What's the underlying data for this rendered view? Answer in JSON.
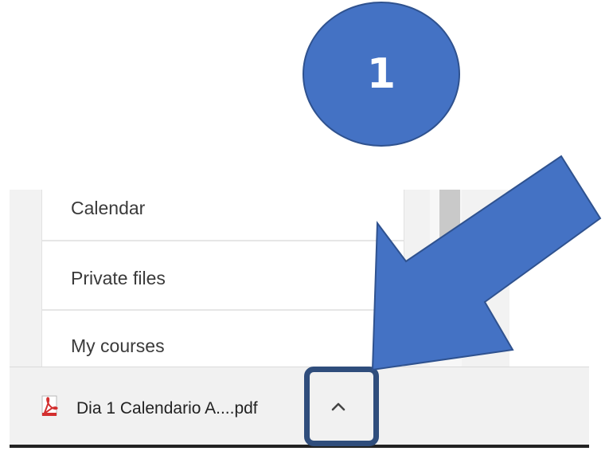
{
  "nav": {
    "items": [
      {
        "label": "Calendar"
      },
      {
        "label": "Private files"
      },
      {
        "label": "My courses"
      }
    ]
  },
  "downloads": {
    "file_name": "Dia 1 Calendario A....pdf",
    "file_icon": "pdf-icon",
    "menu_icon": "chevron-up-icon"
  },
  "annotation": {
    "step_number": "1",
    "circle_color": "#4472c4",
    "arrow_color": "#4472c4",
    "highlight_color": "#2f4d7c"
  }
}
